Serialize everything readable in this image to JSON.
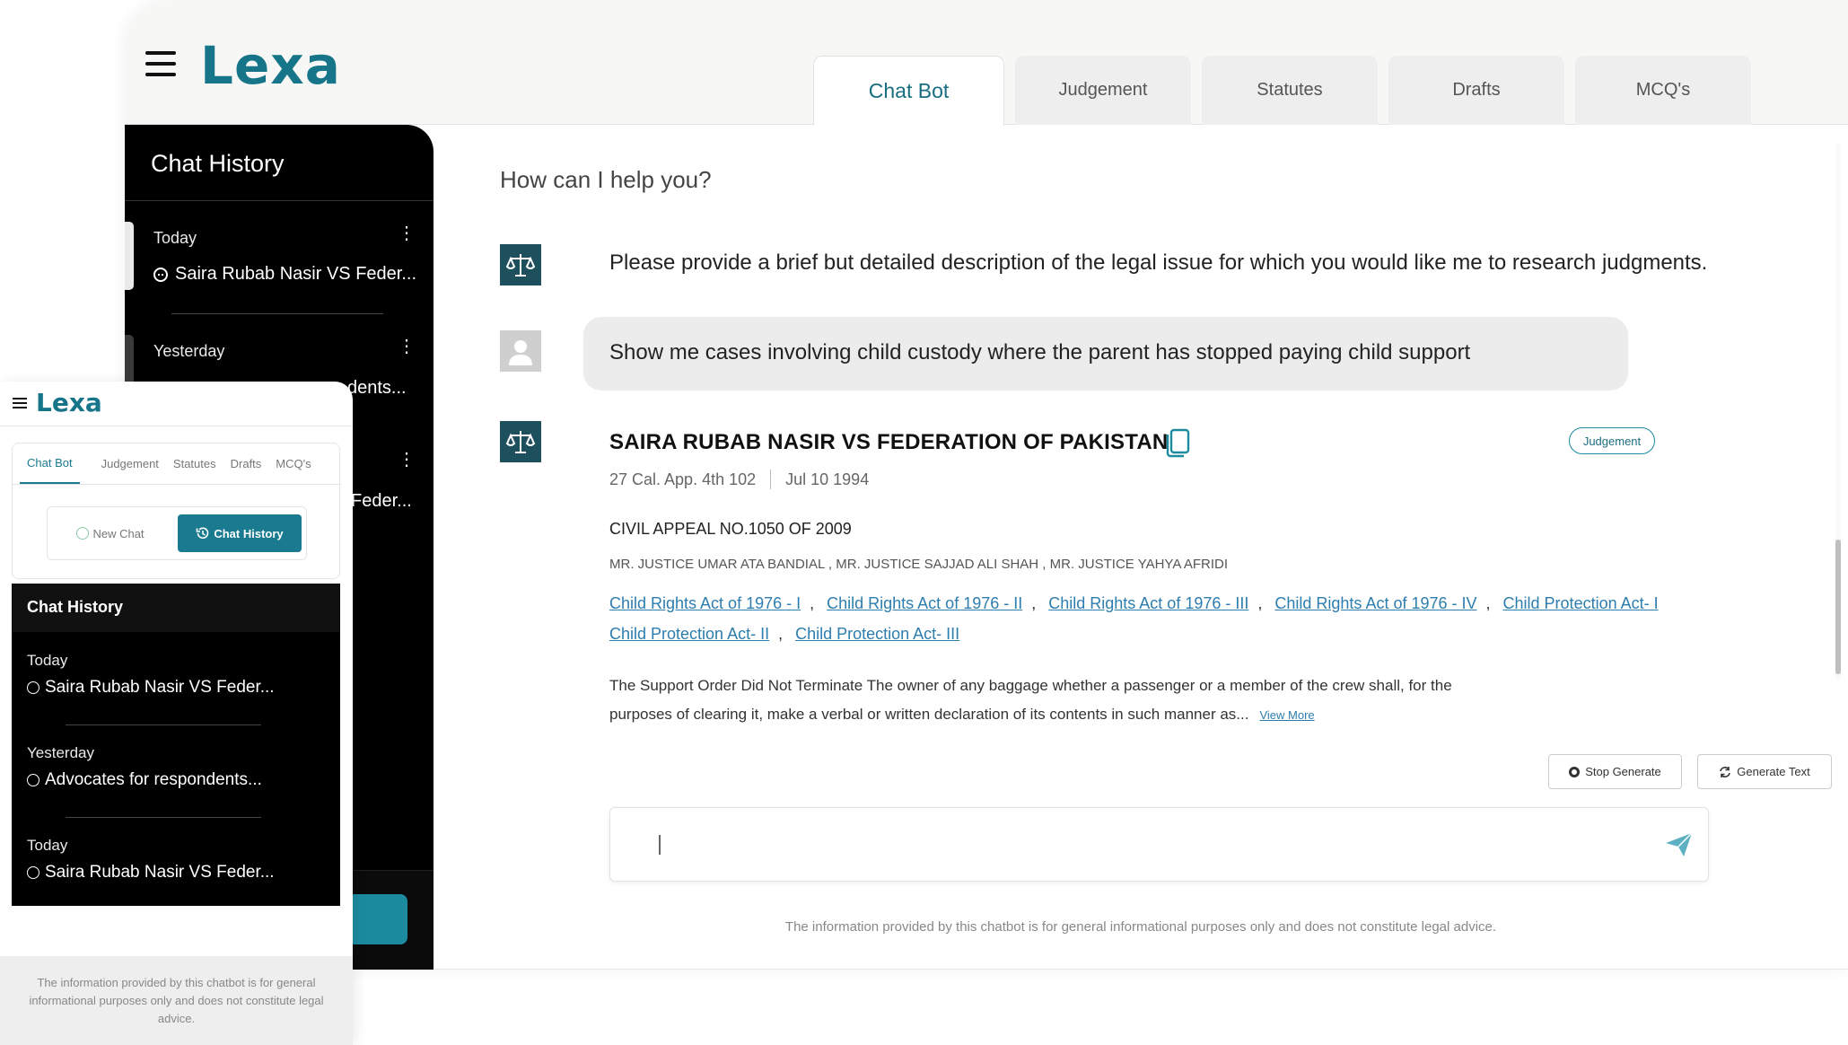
{
  "app": {
    "logo": "Lexa"
  },
  "tabs": [
    "Chat Bot",
    "Judgement",
    "Statutes",
    "Drafts",
    "MCQ's"
  ],
  "sidebar": {
    "title": "Chat History",
    "groups": [
      {
        "date": "Today",
        "item": "Saira Rubab Nasir VS Feder..."
      },
      {
        "date": "Yesterday",
        "item": "dents..."
      },
      {
        "date": "",
        "item": "Feder..."
      }
    ]
  },
  "chat": {
    "prompt": "How can I help you?",
    "bot_message": "Please provide a brief but detailed description of the legal issue for which you would like me to research judgments.",
    "user_message": "Show me cases involving child custody where the parent has stopped paying child support"
  },
  "case": {
    "title": "SAIRA RUBAB NASIR VS FEDERATION OF PAKISTAN",
    "badge": "Judgement",
    "citation": "27 Cal. App. 4th 102",
    "date": "Jul 10 1994",
    "appeal": "CIVIL APPEAL NO.1050 OF 2009",
    "judges": "MR. JUSTICE UMAR ATA BANDIAL , MR. JUSTICE SAJJAD ALI SHAH , MR. JUSTICE YAHYA AFRIDI",
    "links": [
      "Child Rights Act of 1976 - I",
      "Child Rights Act of 1976 - II",
      "Child Rights Act of 1976 - III",
      "Child Rights Act of 1976 - IV",
      "Child Protection Act- I",
      "Child Protection Act- II",
      "Child Protection Act- III"
    ],
    "separator": ",",
    "summary": "The Support Order Did Not Terminate The owner of any baggage whether a passenger or a member of the crew shall, for the purposes of clearing it, make a verbal or written declaration of its contents in such manner as...",
    "view_more": "View More"
  },
  "actions": {
    "stop": "Stop Generate",
    "generate": "Generate Text"
  },
  "input": {
    "value": "",
    "placeholder": ""
  },
  "disclaimer": "The information provided by this chatbot is for general informational purposes only and does not constitute legal advice.",
  "mobile": {
    "logo": "Lexa",
    "tabs": [
      "Chat Bot",
      "Judgement",
      "Statutes",
      "Drafts",
      "MCQ's"
    ],
    "new_chat": "New Chat",
    "chat_history": "Chat History",
    "panel_title": "Chat History",
    "groups": [
      {
        "date": "Today",
        "item": "Saira Rubab Nasir VS Feder..."
      },
      {
        "date": "Yesterday",
        "item": "Advocates for respondents..."
      },
      {
        "date": "Today",
        "item": "Saira Rubab Nasir VS Feder..."
      }
    ],
    "disclaimer": "The information provided by this chatbot is for general informational purposes only and does not constitute legal advice."
  },
  "colors": {
    "accent": "#1a7b90",
    "bot_avatar": "#1e4f5c",
    "link": "#2d7dae"
  },
  "icons": [
    "menu-icon",
    "scale-icon",
    "user-icon",
    "copy-icon",
    "send-icon",
    "chat-icon",
    "history-icon",
    "more-vertical-icon",
    "stop-icon",
    "refresh-icon"
  ]
}
